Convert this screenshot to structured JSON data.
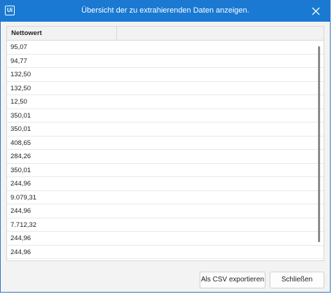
{
  "window": {
    "title": "Übersicht der zu extrahierenden Daten anzeigen.",
    "app_icon_text": "Ui"
  },
  "table": {
    "columns": [
      "Nettowert"
    ],
    "rows": [
      "95,07",
      "94,77",
      "132,50",
      "132,50",
      "12,50",
      "350,01",
      "350,01",
      "408,65",
      "284,26",
      "350,01",
      "244,96",
      "9.079,31",
      "244,96",
      "7.712,32",
      "244,96",
      "244,96"
    ]
  },
  "buttons": {
    "export_label": "Als CSV exportieren",
    "close_label": "Schließen"
  }
}
